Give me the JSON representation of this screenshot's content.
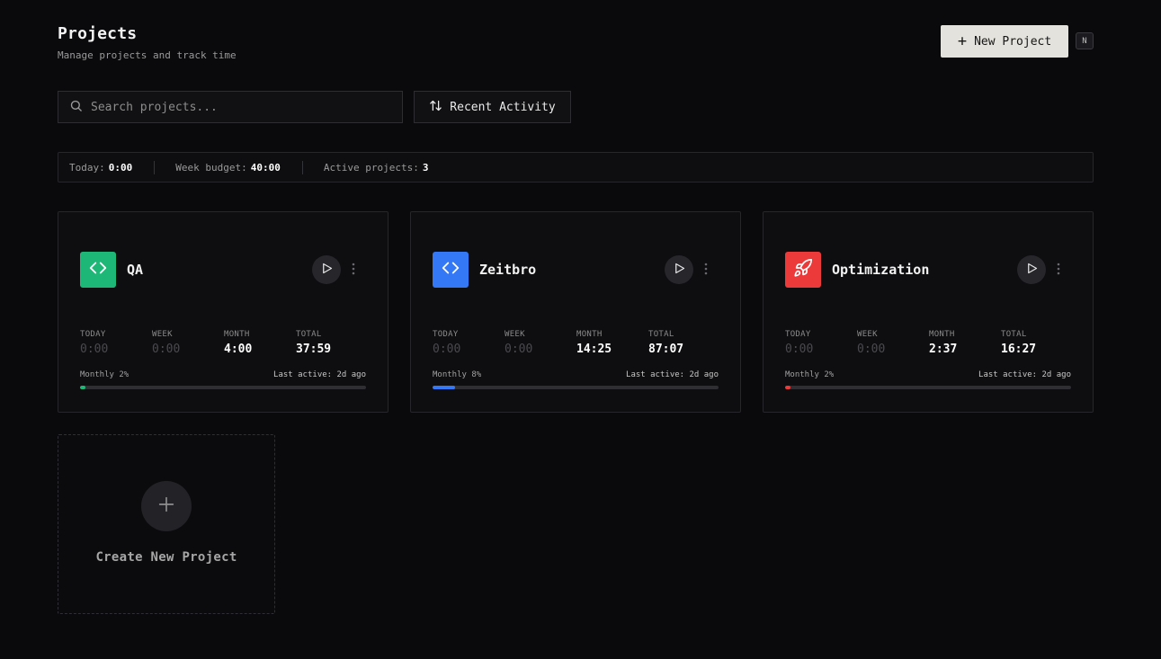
{
  "header": {
    "title": "Projects",
    "subtitle": "Manage projects and track time",
    "new_project_label": "New Project",
    "shortcut_key": "N"
  },
  "toolbar": {
    "search_placeholder": "Search projects...",
    "search_value": "",
    "sort_label": "Recent Activity"
  },
  "stats": {
    "today_label": "Today:",
    "today_value": "0:00",
    "week_budget_label": "Week budget:",
    "week_budget_value": "40:00",
    "active_label": "Active projects:",
    "active_value": "3"
  },
  "stat_labels": {
    "today": "TODAY",
    "week": "WEEK",
    "month": "MONTH",
    "total": "TOTAL"
  },
  "projects": [
    {
      "name": "QA",
      "icon": "code-icon",
      "color": "#1db877",
      "today": "0:00",
      "week": "0:00",
      "month": "4:00",
      "total": "37:59",
      "monthly_label": "Monthly 2%",
      "monthly_percent": 2,
      "last_active": "Last active: 2d ago"
    },
    {
      "name": "Zeitbro",
      "icon": "code-icon",
      "color": "#3478f6",
      "today": "0:00",
      "week": "0:00",
      "month": "14:25",
      "total": "87:07",
      "monthly_label": "Monthly 8%",
      "monthly_percent": 8,
      "last_active": "Last active: 2d ago"
    },
    {
      "name": "Optimization",
      "icon": "rocket-icon",
      "color": "#ec3a3a",
      "today": "0:00",
      "week": "0:00",
      "month": "2:37",
      "total": "16:27",
      "monthly_label": "Monthly 2%",
      "monthly_percent": 2,
      "last_active": "Last active: 2d ago"
    }
  ],
  "create_card": {
    "label": "Create New Project"
  }
}
